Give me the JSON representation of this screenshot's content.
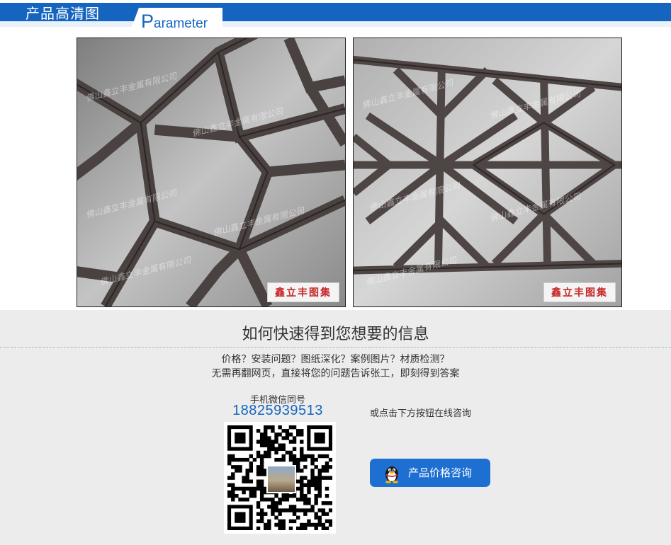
{
  "header": {
    "title": "产品高清图",
    "subtitle_initial": "P",
    "subtitle_rest": "arameter",
    "accent_color": "#1565c0"
  },
  "photos": [
    {
      "stamp": "鑫立丰图集",
      "watermark": "佛山鑫立丰金属有限公司"
    },
    {
      "stamp": "鑫立丰图集",
      "watermark": "佛山鑫立丰金属有限公司"
    }
  ],
  "info": {
    "title": "如何快速得到您想要的信息",
    "questions": "价格？安装问题？图纸深化？案例图片？材质检测？",
    "description": "无需再翻网页，直接将您的问题告诉张工，即刻得到答案",
    "phone_label": "手机微信同号",
    "phone_number": "18825939513",
    "qr_icon": "qr-code",
    "online_hint": "或点击下方按钮在线咨询",
    "consult_button": {
      "label": "产品价格咨询",
      "icon": "qq-penguin-icon",
      "color": "#1d6fd1"
    }
  }
}
